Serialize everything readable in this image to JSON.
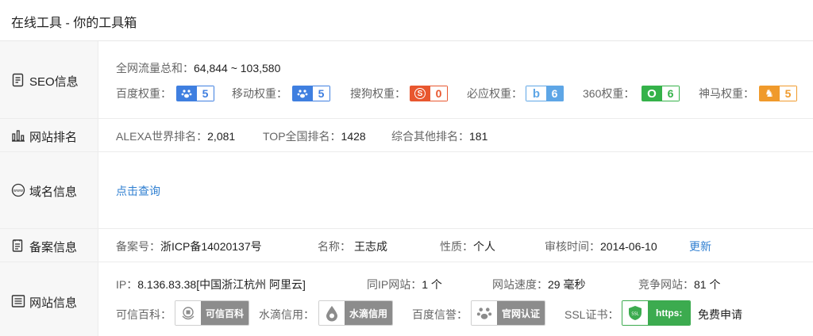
{
  "header": {
    "title": "在线工具 - 你的工具箱"
  },
  "seo": {
    "label": "SEO信息",
    "traffic_label": "全网流量总和：",
    "traffic_value": "64,844 ~ 103,580",
    "weights": [
      {
        "label": "百度权重：",
        "value": "5",
        "color": "#3f7fe0",
        "icon": "paw-icon"
      },
      {
        "label": "移动权重：",
        "value": "5",
        "color": "#3f7fe0",
        "icon": "paw-icon"
      },
      {
        "label": "搜狗权重：",
        "value": "0",
        "color": "#e8572f",
        "icon": "sogou-icon",
        "icon_glyph": "S"
      },
      {
        "label": "必应权重：",
        "value": "6",
        "color": "#5ea6e6",
        "icon": "bing-icon",
        "icon_glyph": "b"
      },
      {
        "label": "360权重：",
        "value": "6",
        "color": "#35b24a",
        "icon": "360-icon",
        "icon_glyph": "O"
      },
      {
        "label": "神马权重：",
        "value": "5",
        "color": "#f09a2b",
        "icon": "shenma-icon",
        "icon_glyph": "♞"
      }
    ]
  },
  "ranking": {
    "label": "网站排名",
    "alexa_label": "ALEXA世界排名：",
    "alexa_value": "2,081",
    "top_label": "TOP全国排名：",
    "top_value": "1428",
    "other_label": "综合其他排名：",
    "other_value": "181"
  },
  "domain": {
    "label": "域名信息",
    "query_link": "点击查询"
  },
  "beian": {
    "label": "备案信息",
    "number_label": "备案号：",
    "number_value": "浙ICP备14020137号",
    "name_label": "名称：",
    "name_value": "王志成",
    "nature_label": "性质：",
    "nature_value": "个人",
    "audit_label": "审核时间：",
    "audit_value": "2014-06-10",
    "update_link": "更新"
  },
  "site": {
    "label": "网站信息",
    "ip_label": "IP：",
    "ip_value": "8.136.83.38[中国浙江杭州 阿里云]",
    "same_ip_label": "同IP网站：",
    "same_ip_value": "1 个",
    "speed_label": "网站速度：",
    "speed_value": "29 毫秒",
    "competitor_label": "竞争网站：",
    "competitor_value": "81 个",
    "credit_label": "可信百科：",
    "credit_badge": "可信百科",
    "shuidi_label": "水滴信用：",
    "shuidi_badge": "水滴信用",
    "baidu_label": "百度信誉：",
    "baidu_badge": "官网认证",
    "ssl_label": "SSL证书：",
    "ssl_badge": "https:",
    "ssl_icon_text": "SSL",
    "ssl_apply": "免费申请"
  }
}
